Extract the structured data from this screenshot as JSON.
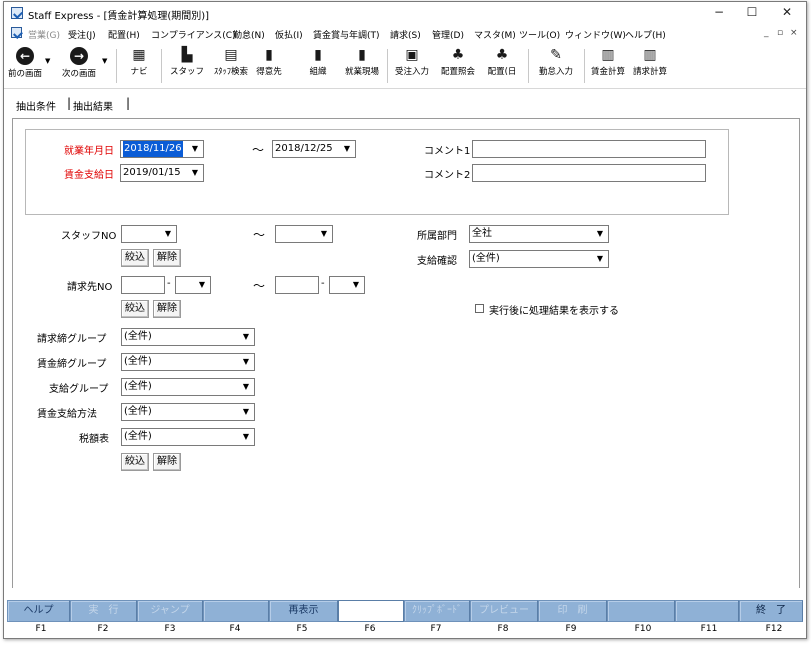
{
  "window": {
    "title": "Staff Express - [賃金計算処理(期間別)]",
    "controls": [
      "−",
      "☐",
      "✕"
    ]
  },
  "menu": {
    "items": [
      {
        "label": "営業(G)",
        "disabled": true
      },
      {
        "label": "受注(J)"
      },
      {
        "label": "配置(H)"
      },
      {
        "label": "コンプライアンス(C)"
      },
      {
        "label": "勤怠(N)"
      },
      {
        "label": "仮払(I)"
      },
      {
        "label": "賃金賞与年調(T)"
      },
      {
        "label": "請求(S)"
      },
      {
        "label": "管理(D)"
      },
      {
        "label": "マスタ(M)"
      },
      {
        "label": "ツール(O)"
      },
      {
        "label": "ウィンドウ(W)"
      },
      {
        "label": "ヘルプ(H)"
      }
    ],
    "mdi_controls": [
      "_",
      "▫",
      "×"
    ]
  },
  "toolbar": {
    "prev": "前の画面",
    "next": "次の画面",
    "navi": "ナビ",
    "staff": "スタッフ",
    "staff_search": "ｽﾀｯﾌ検索",
    "client": "得意先",
    "org": "組織",
    "worksite": "就業現場",
    "order_entry": "受注入力",
    "assign_ref": "配置照会",
    "assign_day": "配置(日",
    "attendance": "勤怠入力",
    "wage_calc": "賃金計算",
    "bill_calc": "請求計算"
  },
  "tabs": {
    "conditions": "抽出条件",
    "results": "抽出結果"
  },
  "form": {
    "work_month_label": "就業年月日",
    "work_from": "2018/11/26",
    "tilde": "～",
    "work_to": "2018/12/25",
    "pay_date_label": "賃金支給日",
    "pay_date": "2019/01/15",
    "comment1_label": "コメント1",
    "comment1": "",
    "comment2_label": "コメント2",
    "comment2": "",
    "staff_no_label": "スタッフNO",
    "narrow": "絞込",
    "clear": "解除",
    "billing_no_label": "請求先NO",
    "dept_label": "所属部門",
    "dept_value": "全社",
    "pay_confirm_label": "支給確認",
    "all": "(全件)",
    "show_result_label": "実行後に処理結果を表示する",
    "billing_close_group_label": "請求締グループ",
    "wage_close_group_label": "賃金締グループ",
    "pay_group_label": "支給グループ",
    "wage_pay_method_label": "賃金支給方法",
    "tax_table_label": "税額表"
  },
  "fkeys": [
    {
      "key": "F1",
      "label": "ヘルプ"
    },
    {
      "key": "F2",
      "label": "実　行"
    },
    {
      "key": "F3",
      "label": "ジャンプ"
    },
    {
      "key": "F4",
      "label": ""
    },
    {
      "key": "F5",
      "label": "再表示"
    },
    {
      "key": "F6",
      "label": ""
    },
    {
      "key": "F7",
      "label": "ｸﾘｯﾌﾟﾎﾞｰﾄﾞ"
    },
    {
      "key": "F8",
      "label": "プレビュー"
    },
    {
      "key": "F9",
      "label": "印　刷"
    },
    {
      "key": "F10",
      "label": ""
    },
    {
      "key": "F11",
      "label": ""
    },
    {
      "key": "F12",
      "label": "終　了"
    }
  ]
}
